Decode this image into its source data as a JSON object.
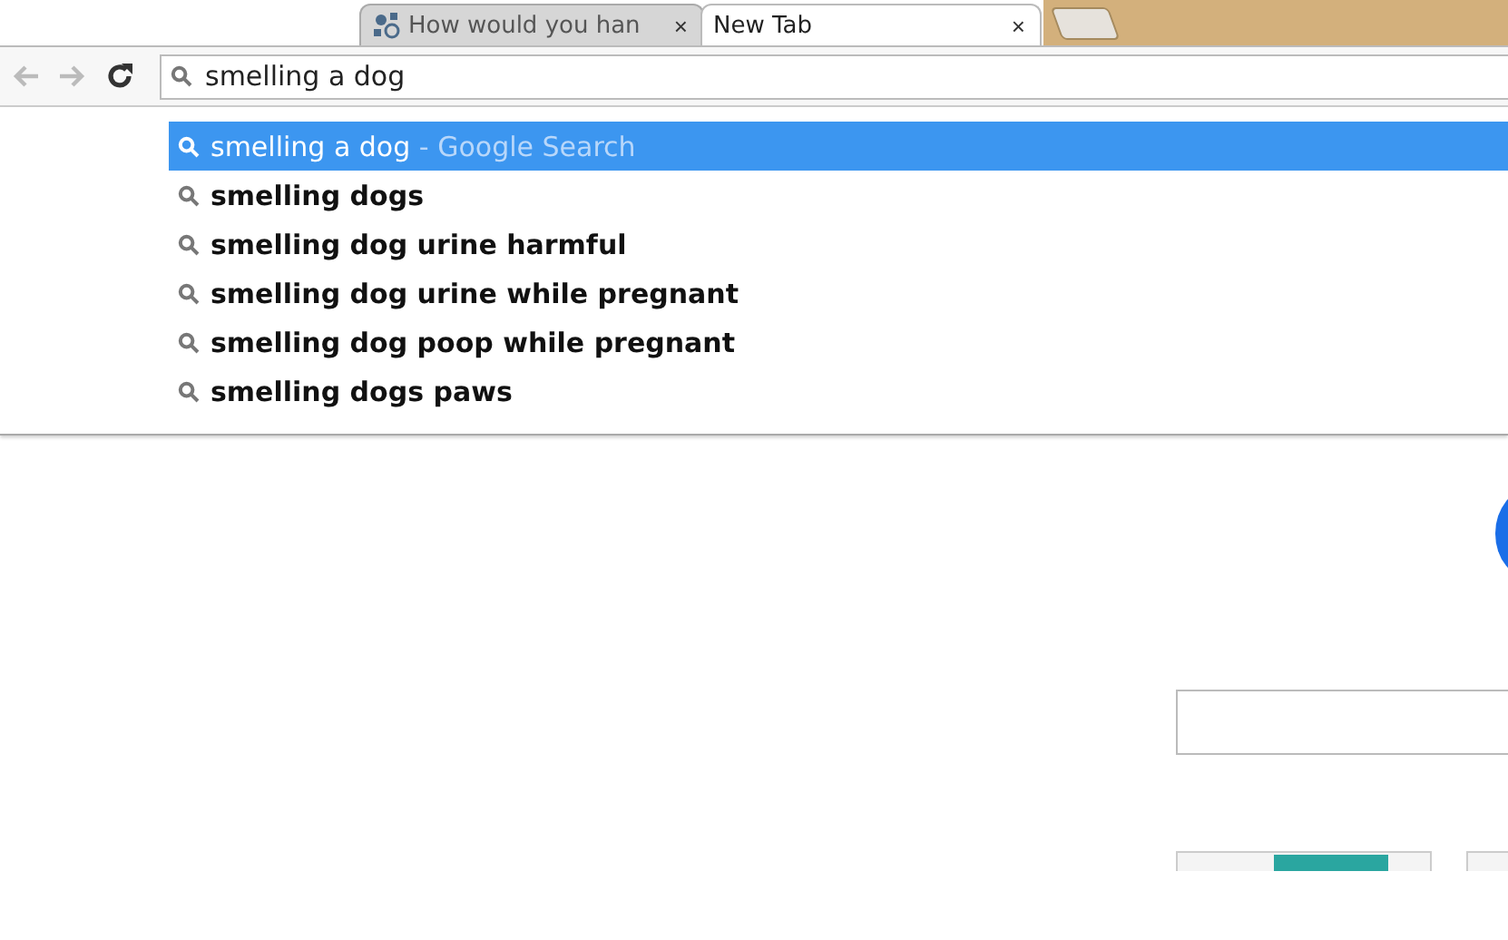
{
  "tabs": [
    {
      "title": "How would you han",
      "close": "×",
      "selected": false
    },
    {
      "title": "New Tab",
      "close": "×",
      "selected": true
    }
  ],
  "omnibox": {
    "value": "smelling a dog"
  },
  "suggestions": [
    {
      "text": "smelling a dog",
      "suffix": "- Google Search",
      "selected": true
    },
    {
      "text": "smelling dogs",
      "selected": false
    },
    {
      "text": "smelling dog urine harmful",
      "selected": false
    },
    {
      "text": "smelling dog urine while pregnant",
      "selected": false
    },
    {
      "text": "smelling dog poop while pregnant",
      "selected": false
    },
    {
      "text": "smelling dogs paws",
      "selected": false
    }
  ]
}
